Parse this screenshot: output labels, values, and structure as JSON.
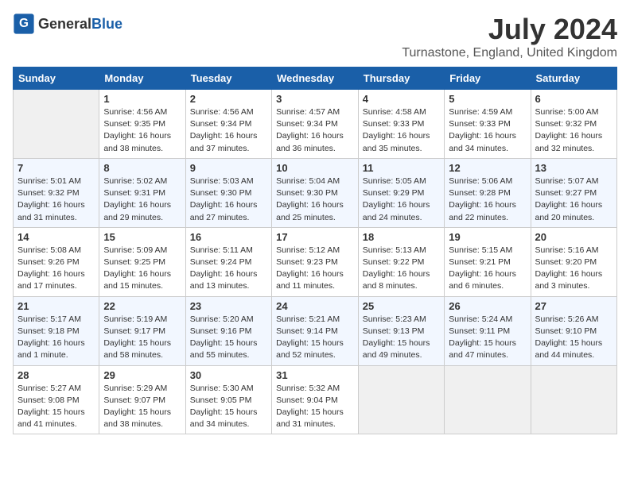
{
  "header": {
    "logo_general": "General",
    "logo_blue": "Blue",
    "month_title": "July 2024",
    "location": "Turnastone, England, United Kingdom"
  },
  "weekdays": [
    "Sunday",
    "Monday",
    "Tuesday",
    "Wednesday",
    "Thursday",
    "Friday",
    "Saturday"
  ],
  "weeks": [
    [
      {
        "day": "",
        "info": ""
      },
      {
        "day": "1",
        "info": "Sunrise: 4:56 AM\nSunset: 9:35 PM\nDaylight: 16 hours\nand 38 minutes."
      },
      {
        "day": "2",
        "info": "Sunrise: 4:56 AM\nSunset: 9:34 PM\nDaylight: 16 hours\nand 37 minutes."
      },
      {
        "day": "3",
        "info": "Sunrise: 4:57 AM\nSunset: 9:34 PM\nDaylight: 16 hours\nand 36 minutes."
      },
      {
        "day": "4",
        "info": "Sunrise: 4:58 AM\nSunset: 9:33 PM\nDaylight: 16 hours\nand 35 minutes."
      },
      {
        "day": "5",
        "info": "Sunrise: 4:59 AM\nSunset: 9:33 PM\nDaylight: 16 hours\nand 34 minutes."
      },
      {
        "day": "6",
        "info": "Sunrise: 5:00 AM\nSunset: 9:32 PM\nDaylight: 16 hours\nand 32 minutes."
      }
    ],
    [
      {
        "day": "7",
        "info": "Sunrise: 5:01 AM\nSunset: 9:32 PM\nDaylight: 16 hours\nand 31 minutes."
      },
      {
        "day": "8",
        "info": "Sunrise: 5:02 AM\nSunset: 9:31 PM\nDaylight: 16 hours\nand 29 minutes."
      },
      {
        "day": "9",
        "info": "Sunrise: 5:03 AM\nSunset: 9:30 PM\nDaylight: 16 hours\nand 27 minutes."
      },
      {
        "day": "10",
        "info": "Sunrise: 5:04 AM\nSunset: 9:30 PM\nDaylight: 16 hours\nand 25 minutes."
      },
      {
        "day": "11",
        "info": "Sunrise: 5:05 AM\nSunset: 9:29 PM\nDaylight: 16 hours\nand 24 minutes."
      },
      {
        "day": "12",
        "info": "Sunrise: 5:06 AM\nSunset: 9:28 PM\nDaylight: 16 hours\nand 22 minutes."
      },
      {
        "day": "13",
        "info": "Sunrise: 5:07 AM\nSunset: 9:27 PM\nDaylight: 16 hours\nand 20 minutes."
      }
    ],
    [
      {
        "day": "14",
        "info": "Sunrise: 5:08 AM\nSunset: 9:26 PM\nDaylight: 16 hours\nand 17 minutes."
      },
      {
        "day": "15",
        "info": "Sunrise: 5:09 AM\nSunset: 9:25 PM\nDaylight: 16 hours\nand 15 minutes."
      },
      {
        "day": "16",
        "info": "Sunrise: 5:11 AM\nSunset: 9:24 PM\nDaylight: 16 hours\nand 13 minutes."
      },
      {
        "day": "17",
        "info": "Sunrise: 5:12 AM\nSunset: 9:23 PM\nDaylight: 16 hours\nand 11 minutes."
      },
      {
        "day": "18",
        "info": "Sunrise: 5:13 AM\nSunset: 9:22 PM\nDaylight: 16 hours\nand 8 minutes."
      },
      {
        "day": "19",
        "info": "Sunrise: 5:15 AM\nSunset: 9:21 PM\nDaylight: 16 hours\nand 6 minutes."
      },
      {
        "day": "20",
        "info": "Sunrise: 5:16 AM\nSunset: 9:20 PM\nDaylight: 16 hours\nand 3 minutes."
      }
    ],
    [
      {
        "day": "21",
        "info": "Sunrise: 5:17 AM\nSunset: 9:18 PM\nDaylight: 16 hours\nand 1 minute."
      },
      {
        "day": "22",
        "info": "Sunrise: 5:19 AM\nSunset: 9:17 PM\nDaylight: 15 hours\nand 58 minutes."
      },
      {
        "day": "23",
        "info": "Sunrise: 5:20 AM\nSunset: 9:16 PM\nDaylight: 15 hours\nand 55 minutes."
      },
      {
        "day": "24",
        "info": "Sunrise: 5:21 AM\nSunset: 9:14 PM\nDaylight: 15 hours\nand 52 minutes."
      },
      {
        "day": "25",
        "info": "Sunrise: 5:23 AM\nSunset: 9:13 PM\nDaylight: 15 hours\nand 49 minutes."
      },
      {
        "day": "26",
        "info": "Sunrise: 5:24 AM\nSunset: 9:11 PM\nDaylight: 15 hours\nand 47 minutes."
      },
      {
        "day": "27",
        "info": "Sunrise: 5:26 AM\nSunset: 9:10 PM\nDaylight: 15 hours\nand 44 minutes."
      }
    ],
    [
      {
        "day": "28",
        "info": "Sunrise: 5:27 AM\nSunset: 9:08 PM\nDaylight: 15 hours\nand 41 minutes."
      },
      {
        "day": "29",
        "info": "Sunrise: 5:29 AM\nSunset: 9:07 PM\nDaylight: 15 hours\nand 38 minutes."
      },
      {
        "day": "30",
        "info": "Sunrise: 5:30 AM\nSunset: 9:05 PM\nDaylight: 15 hours\nand 34 minutes."
      },
      {
        "day": "31",
        "info": "Sunrise: 5:32 AM\nSunset: 9:04 PM\nDaylight: 15 hours\nand 31 minutes."
      },
      {
        "day": "",
        "info": ""
      },
      {
        "day": "",
        "info": ""
      },
      {
        "day": "",
        "info": ""
      }
    ]
  ]
}
